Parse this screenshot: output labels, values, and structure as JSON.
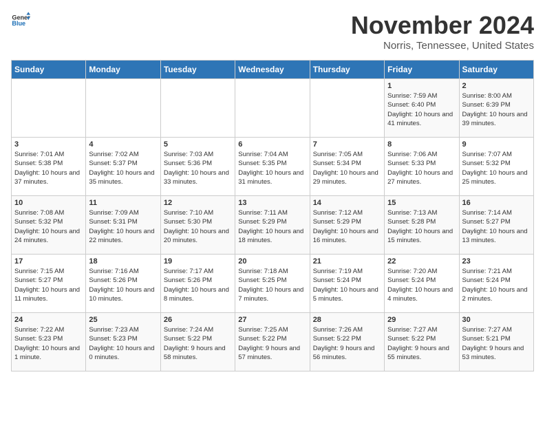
{
  "logo": {
    "general": "General",
    "blue": "Blue"
  },
  "title": "November 2024",
  "location": "Norris, Tennessee, United States",
  "days_header": [
    "Sunday",
    "Monday",
    "Tuesday",
    "Wednesday",
    "Thursday",
    "Friday",
    "Saturday"
  ],
  "weeks": [
    [
      {
        "day": "",
        "info": ""
      },
      {
        "day": "",
        "info": ""
      },
      {
        "day": "",
        "info": ""
      },
      {
        "day": "",
        "info": ""
      },
      {
        "day": "",
        "info": ""
      },
      {
        "day": "1",
        "info": "Sunrise: 7:59 AM\nSunset: 6:40 PM\nDaylight: 10 hours and 41 minutes."
      },
      {
        "day": "2",
        "info": "Sunrise: 8:00 AM\nSunset: 6:39 PM\nDaylight: 10 hours and 39 minutes."
      }
    ],
    [
      {
        "day": "3",
        "info": "Sunrise: 7:01 AM\nSunset: 5:38 PM\nDaylight: 10 hours and 37 minutes."
      },
      {
        "day": "4",
        "info": "Sunrise: 7:02 AM\nSunset: 5:37 PM\nDaylight: 10 hours and 35 minutes."
      },
      {
        "day": "5",
        "info": "Sunrise: 7:03 AM\nSunset: 5:36 PM\nDaylight: 10 hours and 33 minutes."
      },
      {
        "day": "6",
        "info": "Sunrise: 7:04 AM\nSunset: 5:35 PM\nDaylight: 10 hours and 31 minutes."
      },
      {
        "day": "7",
        "info": "Sunrise: 7:05 AM\nSunset: 5:34 PM\nDaylight: 10 hours and 29 minutes."
      },
      {
        "day": "8",
        "info": "Sunrise: 7:06 AM\nSunset: 5:33 PM\nDaylight: 10 hours and 27 minutes."
      },
      {
        "day": "9",
        "info": "Sunrise: 7:07 AM\nSunset: 5:32 PM\nDaylight: 10 hours and 25 minutes."
      }
    ],
    [
      {
        "day": "10",
        "info": "Sunrise: 7:08 AM\nSunset: 5:32 PM\nDaylight: 10 hours and 24 minutes."
      },
      {
        "day": "11",
        "info": "Sunrise: 7:09 AM\nSunset: 5:31 PM\nDaylight: 10 hours and 22 minutes."
      },
      {
        "day": "12",
        "info": "Sunrise: 7:10 AM\nSunset: 5:30 PM\nDaylight: 10 hours and 20 minutes."
      },
      {
        "day": "13",
        "info": "Sunrise: 7:11 AM\nSunset: 5:29 PM\nDaylight: 10 hours and 18 minutes."
      },
      {
        "day": "14",
        "info": "Sunrise: 7:12 AM\nSunset: 5:29 PM\nDaylight: 10 hours and 16 minutes."
      },
      {
        "day": "15",
        "info": "Sunrise: 7:13 AM\nSunset: 5:28 PM\nDaylight: 10 hours and 15 minutes."
      },
      {
        "day": "16",
        "info": "Sunrise: 7:14 AM\nSunset: 5:27 PM\nDaylight: 10 hours and 13 minutes."
      }
    ],
    [
      {
        "day": "17",
        "info": "Sunrise: 7:15 AM\nSunset: 5:27 PM\nDaylight: 10 hours and 11 minutes."
      },
      {
        "day": "18",
        "info": "Sunrise: 7:16 AM\nSunset: 5:26 PM\nDaylight: 10 hours and 10 minutes."
      },
      {
        "day": "19",
        "info": "Sunrise: 7:17 AM\nSunset: 5:26 PM\nDaylight: 10 hours and 8 minutes."
      },
      {
        "day": "20",
        "info": "Sunrise: 7:18 AM\nSunset: 5:25 PM\nDaylight: 10 hours and 7 minutes."
      },
      {
        "day": "21",
        "info": "Sunrise: 7:19 AM\nSunset: 5:24 PM\nDaylight: 10 hours and 5 minutes."
      },
      {
        "day": "22",
        "info": "Sunrise: 7:20 AM\nSunset: 5:24 PM\nDaylight: 10 hours and 4 minutes."
      },
      {
        "day": "23",
        "info": "Sunrise: 7:21 AM\nSunset: 5:24 PM\nDaylight: 10 hours and 2 minutes."
      }
    ],
    [
      {
        "day": "24",
        "info": "Sunrise: 7:22 AM\nSunset: 5:23 PM\nDaylight: 10 hours and 1 minute."
      },
      {
        "day": "25",
        "info": "Sunrise: 7:23 AM\nSunset: 5:23 PM\nDaylight: 10 hours and 0 minutes."
      },
      {
        "day": "26",
        "info": "Sunrise: 7:24 AM\nSunset: 5:22 PM\nDaylight: 9 hours and 58 minutes."
      },
      {
        "day": "27",
        "info": "Sunrise: 7:25 AM\nSunset: 5:22 PM\nDaylight: 9 hours and 57 minutes."
      },
      {
        "day": "28",
        "info": "Sunrise: 7:26 AM\nSunset: 5:22 PM\nDaylight: 9 hours and 56 minutes."
      },
      {
        "day": "29",
        "info": "Sunrise: 7:27 AM\nSunset: 5:22 PM\nDaylight: 9 hours and 55 minutes."
      },
      {
        "day": "30",
        "info": "Sunrise: 7:27 AM\nSunset: 5:21 PM\nDaylight: 9 hours and 53 minutes."
      }
    ]
  ]
}
